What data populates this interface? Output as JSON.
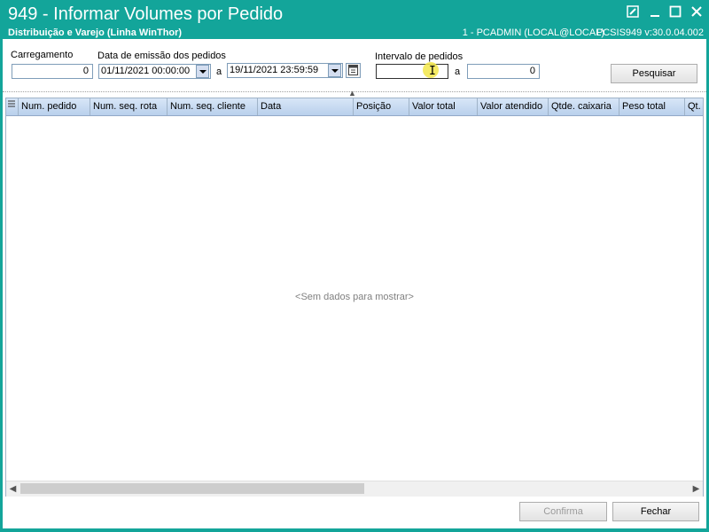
{
  "window": {
    "title": "949 - Informar Volumes por Pedido",
    "subtitle": "Distribuição e Varejo (Linha WinThor)",
    "user_info": "1 - PCADMIN (LOCAL@LOCAL)",
    "version": "PCSIS949  v:30.0.04.002",
    "accent_color": "#13a59a",
    "controls": [
      "edit-icon",
      "minimize-icon",
      "maximize-icon",
      "close-icon"
    ]
  },
  "filters": {
    "carregamento_label": "Carregamento",
    "carregamento_value": "0",
    "data_emissao_label": "Data de emissão dos pedidos",
    "data_inicio": "01/11/2021 00:00:00",
    "a_label": "a",
    "data_fim": "19/11/2021 23:59:59",
    "intervalo_label": "Intervalo de pedidos",
    "intervalo_inicio": "",
    "intervalo_a_label": "a",
    "intervalo_fim": "0",
    "pesquisar_label": "Pesquisar"
  },
  "grid": {
    "columns": [
      "Num. pedido",
      "Num. seq. rota",
      "Num. seq. cliente",
      "Data",
      "Posição",
      "Valor total",
      "Valor atendido",
      "Qtde. caixaria",
      "Peso total",
      "Qt."
    ],
    "empty_text": "<Sem dados para mostrar>"
  },
  "footer": {
    "confirma_label": "Confirma",
    "fechar_label": "Fechar"
  }
}
